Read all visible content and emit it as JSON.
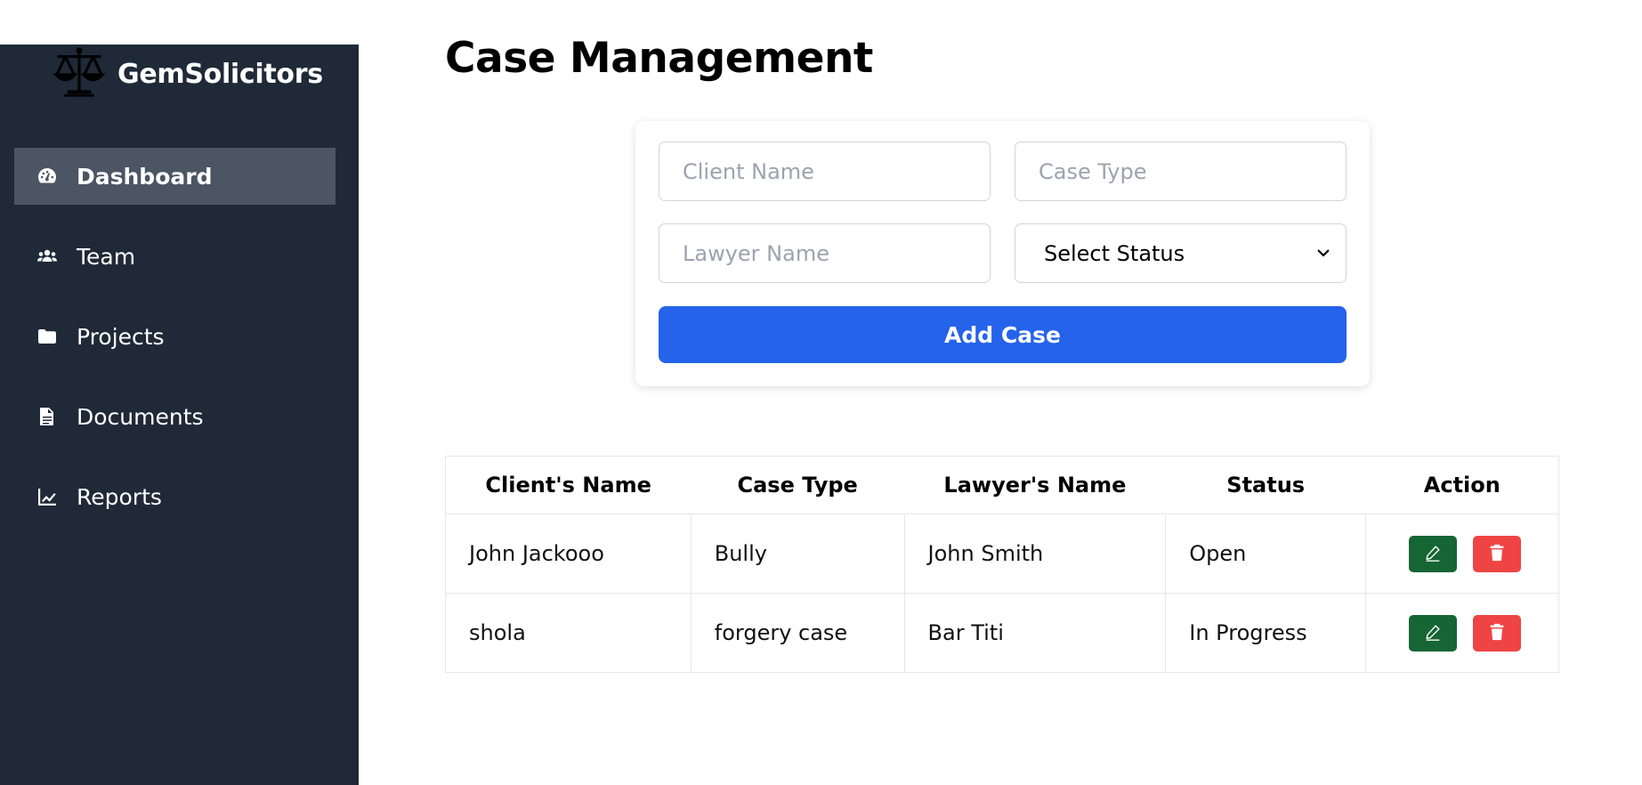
{
  "brand": {
    "name": "GemSolicitors",
    "logo_icon": "scales-icon"
  },
  "nav": {
    "items": [
      {
        "label": "Dashboard",
        "icon": "gauge-icon",
        "active": true
      },
      {
        "label": "Team",
        "icon": "users-icon",
        "active": false
      },
      {
        "label": "Projects",
        "icon": "folder-icon",
        "active": false
      },
      {
        "label": "Documents",
        "icon": "document-icon",
        "active": false
      },
      {
        "label": "Reports",
        "icon": "chart-line-icon",
        "active": false
      }
    ]
  },
  "page": {
    "title": "Case Management"
  },
  "form": {
    "client_placeholder": "Client Name",
    "client_value": "",
    "case_type_placeholder": "Case Type",
    "case_type_value": "",
    "lawyer_placeholder": "Lawyer Name",
    "lawyer_value": "",
    "status_selected": "Select Status",
    "submit_label": "Add Case"
  },
  "table": {
    "headers": [
      "Client's Name",
      "Case Type",
      "Lawyer's Name",
      "Status",
      "Action"
    ],
    "rows": [
      {
        "client": "John Jackooo",
        "case_type": "Bully",
        "lawyer": "John Smith",
        "status": "Open"
      },
      {
        "client": "shola",
        "case_type": "forgery case",
        "lawyer": "Bar Titi",
        "status": "In Progress"
      }
    ]
  },
  "colors": {
    "sidebar_bg": "#1f2937",
    "active_item_bg": "#4b5563",
    "primary": "#2563eb",
    "edit": "#166534",
    "delete": "#ef4444"
  }
}
